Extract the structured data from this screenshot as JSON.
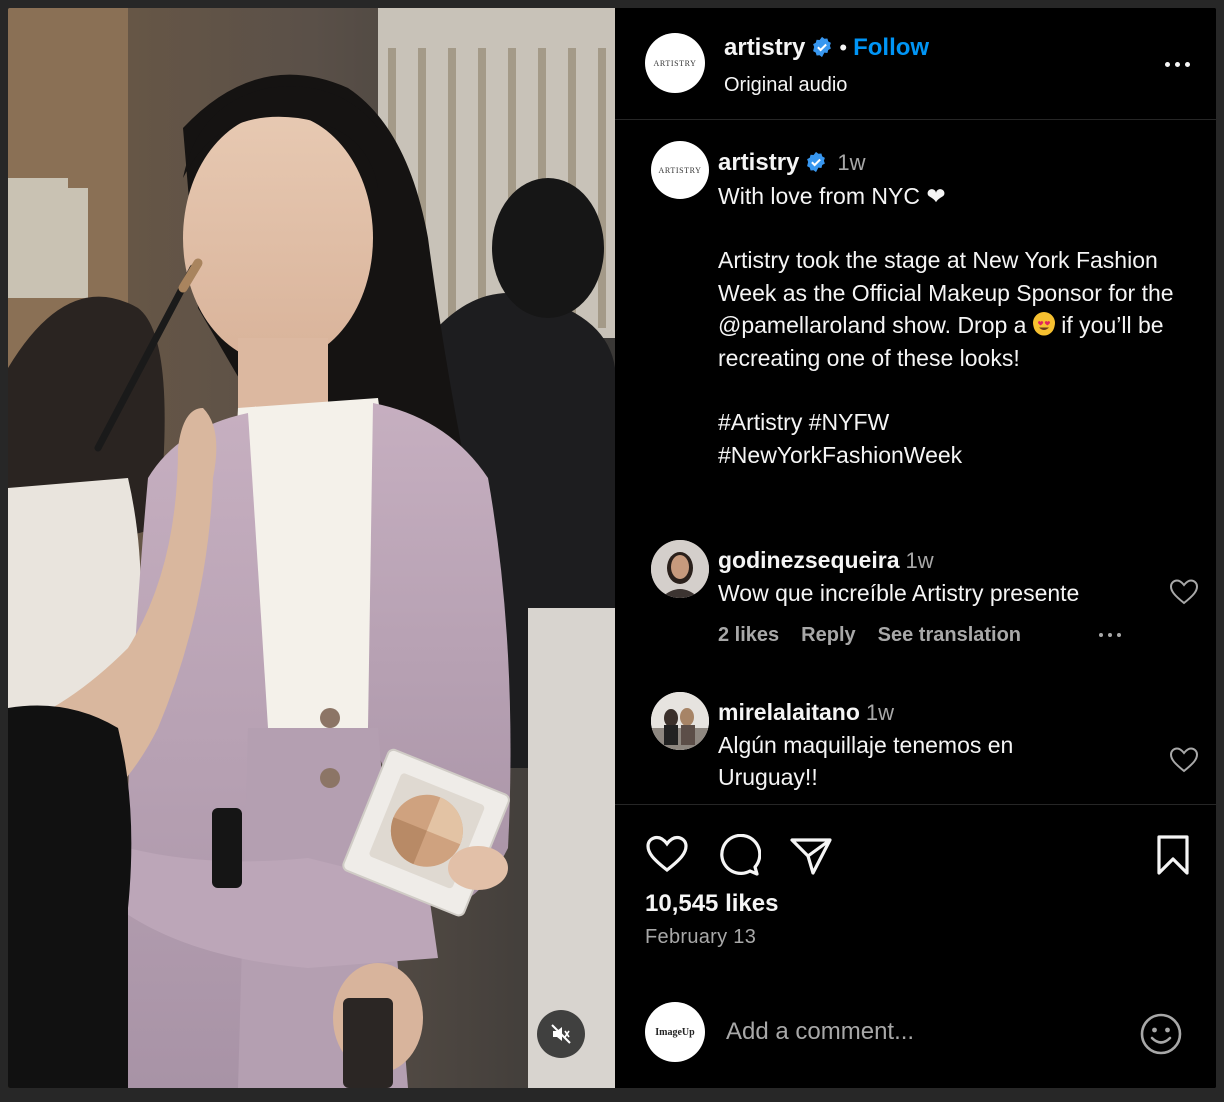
{
  "post": {
    "author": "artistry",
    "avatar_text": "ARTISTRY",
    "follow_label": "Follow",
    "separator": "•",
    "audio": "Original audio"
  },
  "caption": {
    "author": "artistry",
    "time": "1w",
    "line1": "With love from NYC ❤",
    "para2a": "Artistry took the stage at New York Fashion Week as the Official Makeup Sponsor for the @pamellaroland show.",
    "para2b_pre": "Drop a",
    "para2b_post": "if you’ll be recreating one of these looks!",
    "hashtags1": "#Artistry #NYFW",
    "hashtags2": "#NewYorkFashionWeek"
  },
  "comments": [
    {
      "user": "godinezsequeira",
      "time": "1w",
      "text": "Wow que increíble Artistry presente",
      "likes": "2 likes",
      "reply": "Reply",
      "translate": "See translation"
    },
    {
      "user": "mirelalaitano",
      "time": "1w",
      "text": "Algún maquillaje tenemos en Uruguay!!"
    }
  ],
  "stats": {
    "likes": "10,545 likes",
    "date": "February 13"
  },
  "composer": {
    "avatar_text": "ImageUp",
    "placeholder": "Add a comment..."
  },
  "icons": {
    "verified": "verified-badge-icon",
    "more": "more-horizontal-icon",
    "like": "heart-icon",
    "comment": "comment-bubble-icon",
    "share": "paper-plane-icon",
    "save": "bookmark-icon",
    "emoji": "smiley-icon",
    "mute": "speaker-muted-icon"
  },
  "colors": {
    "background": "#000000",
    "link": "#0095f6",
    "verified": "#3897f0",
    "muted_text": "#a8a8a8"
  }
}
